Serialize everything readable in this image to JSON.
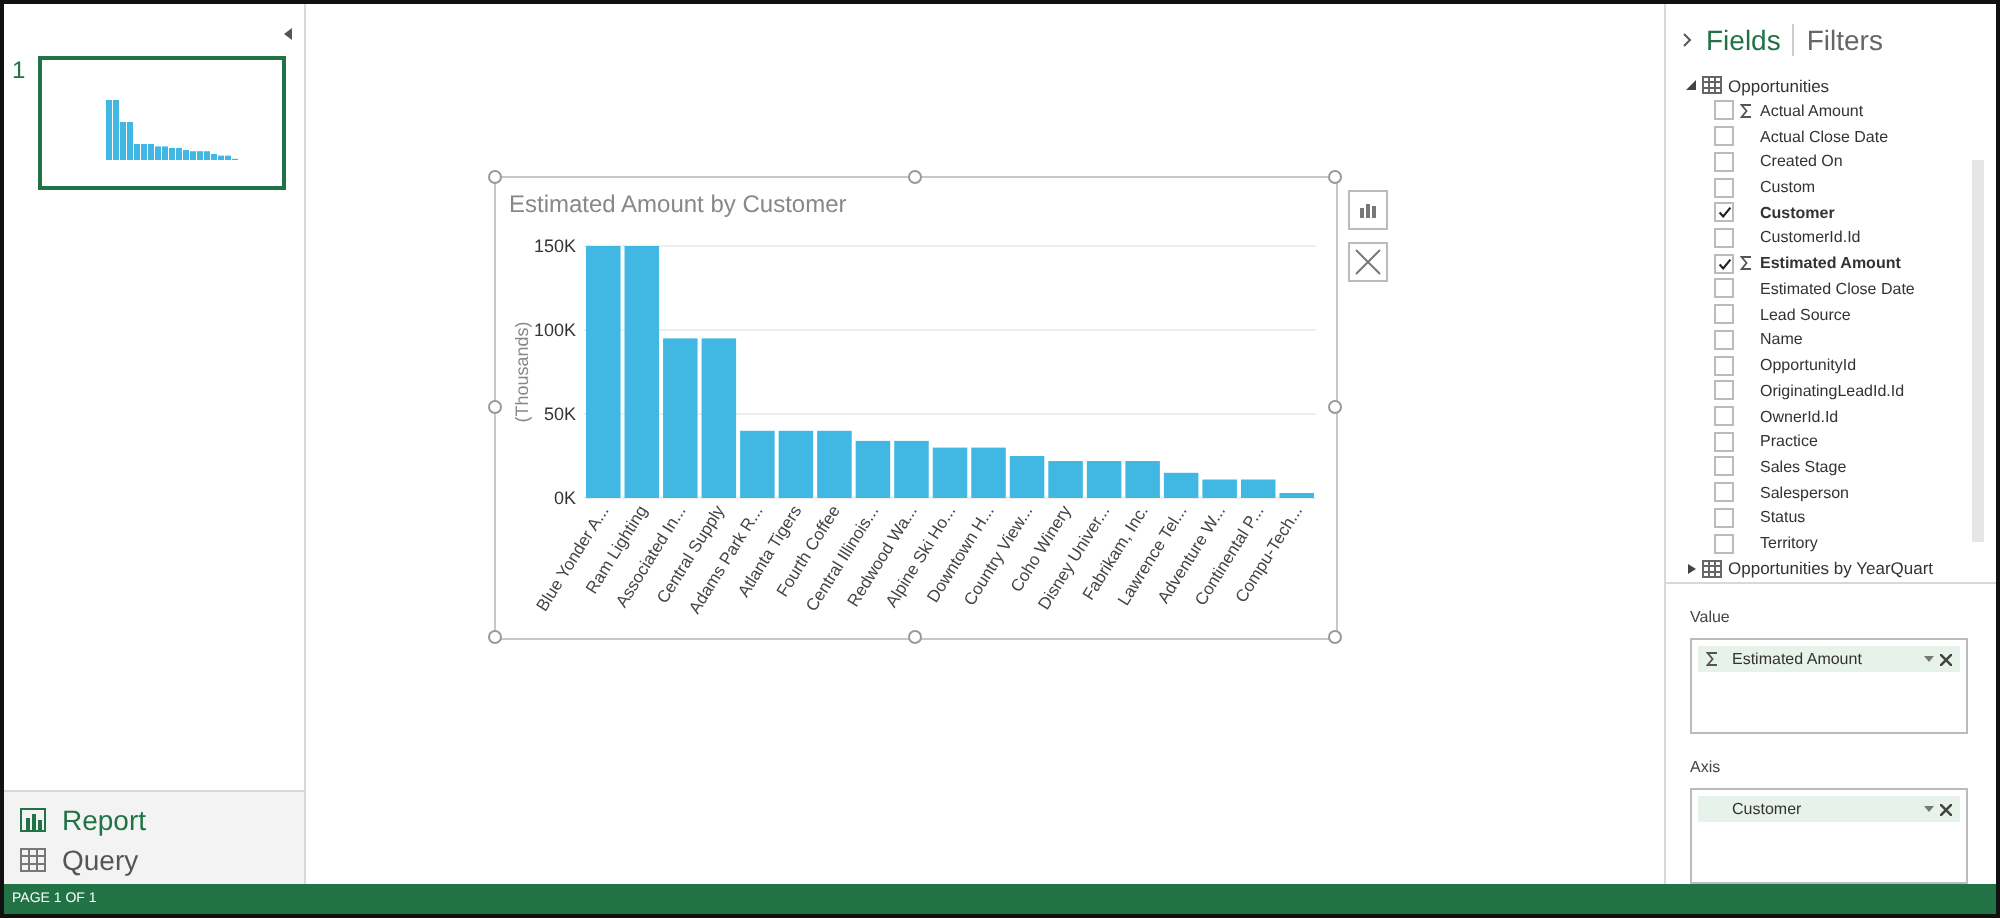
{
  "pages": [
    {
      "number": "1",
      "selected": true
    }
  ],
  "nav": [
    {
      "label": "Report",
      "kind": "report"
    },
    {
      "label": "Query",
      "kind": "query"
    }
  ],
  "chart": {
    "title": "Estimated Amount by Customer",
    "chart_data": {
      "type": "bar",
      "ylabel": "(Thousands)",
      "categories": [
        "Blue Yonder A...",
        "Ram Lighting",
        "Associated In...",
        "Central Supply",
        "Adams Park R...",
        "Atlanta Tigers",
        "Fourth Coffee",
        "Central Illinois...",
        "Redwood Wa...",
        "Alpine Ski Ho...",
        "Downtown H...",
        "Country View...",
        "Coho Winery",
        "Disney Univer...",
        "Fabrikam, Inc.",
        "Lawrence Tel...",
        "Adventure W...",
        "Continental P...",
        "Compu-Tech..."
      ],
      "series": [
        {
          "color": "#41b8e4",
          "values": [
            150,
            150,
            95,
            95,
            40,
            40,
            40,
            34,
            34,
            30,
            30,
            25,
            22,
            22,
            22,
            15,
            11,
            11,
            3
          ]
        }
      ],
      "ylim": [
        0,
        150
      ],
      "yticks": [
        {
          "value": 0,
          "label": "0K"
        },
        {
          "value": 50,
          "label": "50K"
        },
        {
          "value": 100,
          "label": "100K"
        },
        {
          "value": 150,
          "label": "150K"
        }
      ]
    }
  },
  "panel": {
    "tabs": [
      {
        "label": "Fields",
        "selected": true
      },
      {
        "label": "Filters",
        "selected": false
      }
    ],
    "tables": [
      {
        "name": "Opportunities",
        "expanded": true,
        "fields": [
          {
            "label": "Actual Amount",
            "sigma": true,
            "checked": false
          },
          {
            "label": "Actual Close Date",
            "sigma": false,
            "checked": false
          },
          {
            "label": "Created On",
            "sigma": false,
            "checked": false
          },
          {
            "label": "Custom",
            "sigma": false,
            "checked": false
          },
          {
            "label": "Customer",
            "sigma": false,
            "checked": true
          },
          {
            "label": "CustomerId.Id",
            "sigma": false,
            "checked": false
          },
          {
            "label": "Estimated Amount",
            "sigma": true,
            "checked": true
          },
          {
            "label": "Estimated Close Date",
            "sigma": false,
            "checked": false
          },
          {
            "label": "Lead Source",
            "sigma": false,
            "checked": false
          },
          {
            "label": "Name",
            "sigma": false,
            "checked": false
          },
          {
            "label": "OpportunityId",
            "sigma": false,
            "checked": false
          },
          {
            "label": "OriginatingLeadId.Id",
            "sigma": false,
            "checked": false
          },
          {
            "label": "OwnerId.Id",
            "sigma": false,
            "checked": false
          },
          {
            "label": "Practice",
            "sigma": false,
            "checked": false
          },
          {
            "label": "Sales Stage",
            "sigma": false,
            "checked": false
          },
          {
            "label": "Salesperson",
            "sigma": false,
            "checked": false
          },
          {
            "label": "Status",
            "sigma": false,
            "checked": false
          },
          {
            "label": "Territory",
            "sigma": false,
            "checked": false
          }
        ]
      },
      {
        "name": "Opportunities by YearQuart",
        "expanded": false
      }
    ],
    "wells": [
      {
        "label": "Value",
        "items": [
          {
            "label": "Estimated Amount",
            "sigma": true
          }
        ]
      },
      {
        "label": "Axis",
        "items": [
          {
            "label": "Customer",
            "sigma": false
          }
        ]
      }
    ]
  },
  "status_bar": "PAGE 1 OF 1"
}
